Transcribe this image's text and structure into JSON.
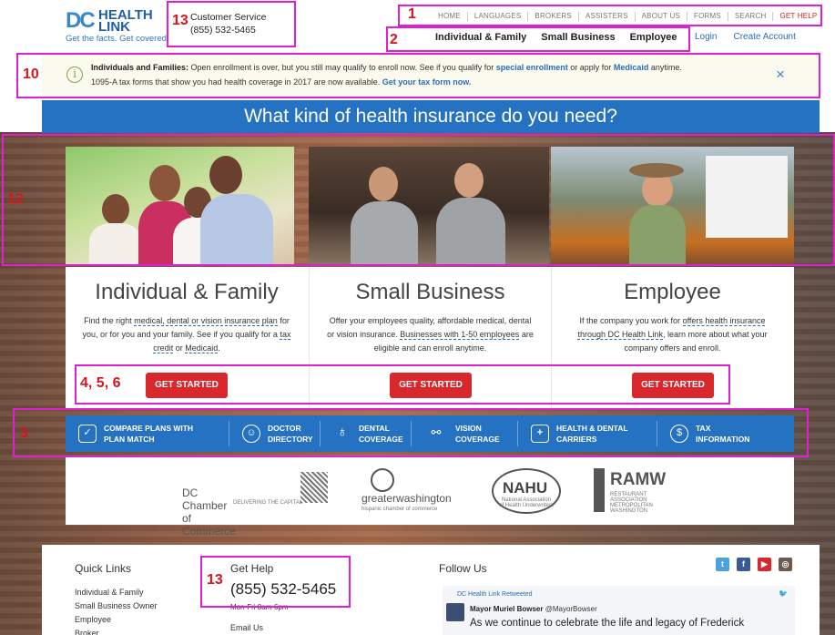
{
  "logo": {
    "dc": "DC",
    "health": "HEALTH",
    "link": "LINK",
    "tagline": "Get the facts. Get covered."
  },
  "customer_service": {
    "label": "Customer Service",
    "phone": "(855) 532-5465"
  },
  "top_nav": [
    "HOME",
    "LANGUAGES",
    "BROKERS",
    "ASSISTERS",
    "ABOUT US",
    "FORMS",
    "SEARCH",
    "GET HELP"
  ],
  "main_nav": [
    "Individual & Family",
    "Small Business",
    "Employee"
  ],
  "account": {
    "login": "Login",
    "create": "Create Account"
  },
  "alert": {
    "bold_lead": "Individuals and Families:",
    "text1": "Open enrollment is over, but you still may qualify to enroll now. See if you qualify for",
    "link1": "special enrollment",
    "text2": "or apply for",
    "link2": "Medicaid",
    "text3": "anytime.",
    "line2_text": "1095-A tax forms that show you had health coverage in 2017 are now available.",
    "line2_link": "Get your tax form now.",
    "close": "×"
  },
  "hero_title": "What kind of health insurance do you need?",
  "cards": [
    {
      "title": "Individual & Family",
      "desc_a": "Find the right",
      "desc_link1": "medical, dental or vision insurance plan",
      "desc_b": "for you, or for you and your family. See if you qualify for a",
      "desc_link2": "tax credit",
      "desc_c": "or",
      "desc_link3": "Medicaid",
      "desc_d": ".",
      "button": "GET STARTED"
    },
    {
      "title": "Small Business",
      "desc_a": "Offer your employees quality, affordable medical, dental or vision insurance.",
      "desc_link1": "Businesses with 1-50 employees",
      "desc_b": "are eligible and can enroll anytime.",
      "button": "GET STARTED"
    },
    {
      "title": "Employee",
      "desc_a": "If the company you work for",
      "desc_link1": "offers health insurance through DC Health Link",
      "desc_b": ", learn more about what your company offers and enroll.",
      "button": "GET STARTED"
    }
  ],
  "tools": [
    {
      "label": "COMPARE PLANS WITH\nPLAN MATCH",
      "icon": "checklist-icon"
    },
    {
      "label": "DOCTOR\nDIRECTORY",
      "icon": "doctor-icon"
    },
    {
      "label": "DENTAL\nCOVERAGE",
      "icon": "tooth-icon"
    },
    {
      "label": "VISION\nCOVERAGE",
      "icon": "glasses-icon"
    },
    {
      "label": "HEALTH & DENTAL\nCARRIERS",
      "icon": "medical-kit-icon"
    },
    {
      "label": "TAX\nINFORMATION",
      "icon": "dollar-icon"
    }
  ],
  "partners": [
    {
      "name": "DC Chamber of Commerce",
      "sub": "DELIVERING THE CAPITAL"
    },
    {
      "name": "greaterwashington",
      "sub": "hispanic chamber of commerce"
    },
    {
      "name": "NAHU",
      "sub": "National Association of Health Underwriters"
    },
    {
      "name": "RAMW",
      "sub": "RESTAURANT ASSOCIATION METROPOLITAN WASHINGTON"
    }
  ],
  "annotations": {
    "a1": "1",
    "a2": "2",
    "a3": "3",
    "a456": "4, 5, 6",
    "a10": "10",
    "a12": "12",
    "a13": "13",
    "a13b": "13"
  },
  "footer": {
    "quick_links_title": "Quick Links",
    "quick_links": [
      "Individual & Family",
      "Small Business Owner",
      "Employee",
      "Broker"
    ],
    "get_help_title": "Get Help",
    "phone": "(855) 532-5465",
    "hours": "Mon-Fri 8am-6pm",
    "email": "Email Us",
    "follow_title": "Follow Us",
    "tweet": {
      "retweeted": "DC Health Link Retweeted",
      "author": "Mayor Muriel Bowser",
      "handle": "@MayorBowser",
      "text": "As we continue to celebrate the life and legacy of Frederick"
    }
  },
  "colors": {
    "brand_blue": "#2672c2",
    "cta_red": "#d8282d",
    "annotation_magenta": "#e020d0",
    "annotation_red": "#d8141c"
  }
}
